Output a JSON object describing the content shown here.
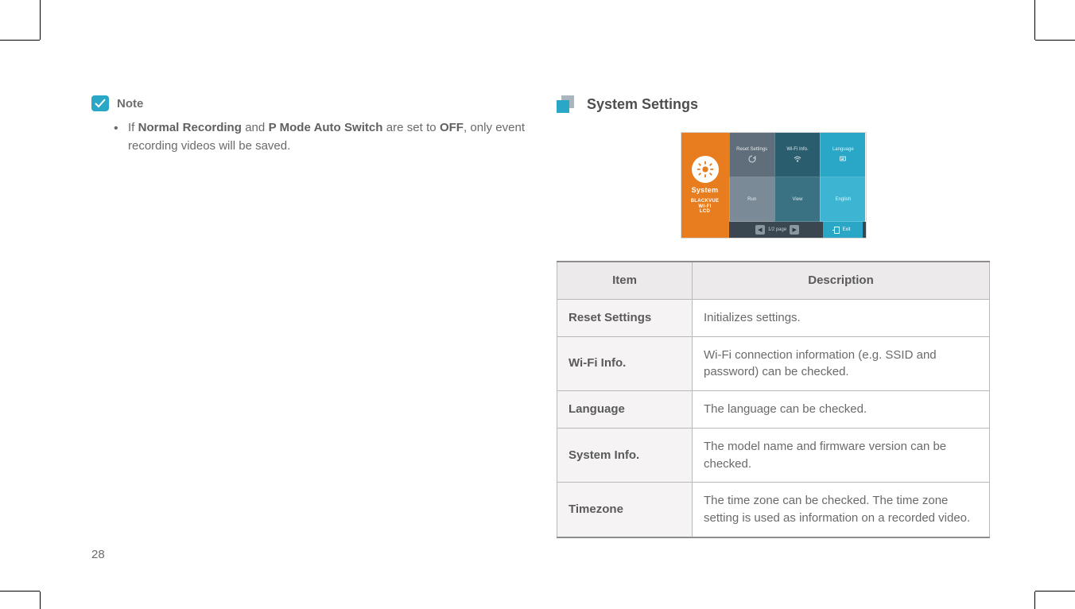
{
  "note": {
    "label": "Note",
    "text_prefix": "If ",
    "bold1": "Normal Recording",
    "mid1": " and ",
    "bold2": "P Mode Auto Switch",
    "mid2": " are set to ",
    "bold3": "OFF",
    "suffix": ", only event recording videos will be saved."
  },
  "section": {
    "title": "System Settings"
  },
  "device": {
    "side_label": "System",
    "brand": "BLACKVUE\nWI-FI\nLCD",
    "tiles": {
      "t0": "Reset Settings",
      "t1": "Wi-Fi Info.",
      "t2": "Language",
      "t3": "Run",
      "t4": "View",
      "t5": "English"
    },
    "pager": "1/2 page",
    "exit": "Exit"
  },
  "table": {
    "head_item": "Item",
    "head_desc": "Description",
    "rows": [
      {
        "item": "Reset Settings",
        "desc": "Initializes settings."
      },
      {
        "item": "Wi-Fi Info.",
        "desc": "Wi-Fi connection information (e.g. SSID and password) can be checked."
      },
      {
        "item": "Language",
        "desc": "The language can be checked."
      },
      {
        "item": "System Info.",
        "desc": "The model name and firmware version can be checked."
      },
      {
        "item": "Timezone",
        "desc": "The time zone can be checked. The time zone setting is used as information on a recorded video."
      }
    ]
  },
  "page_number": "28"
}
